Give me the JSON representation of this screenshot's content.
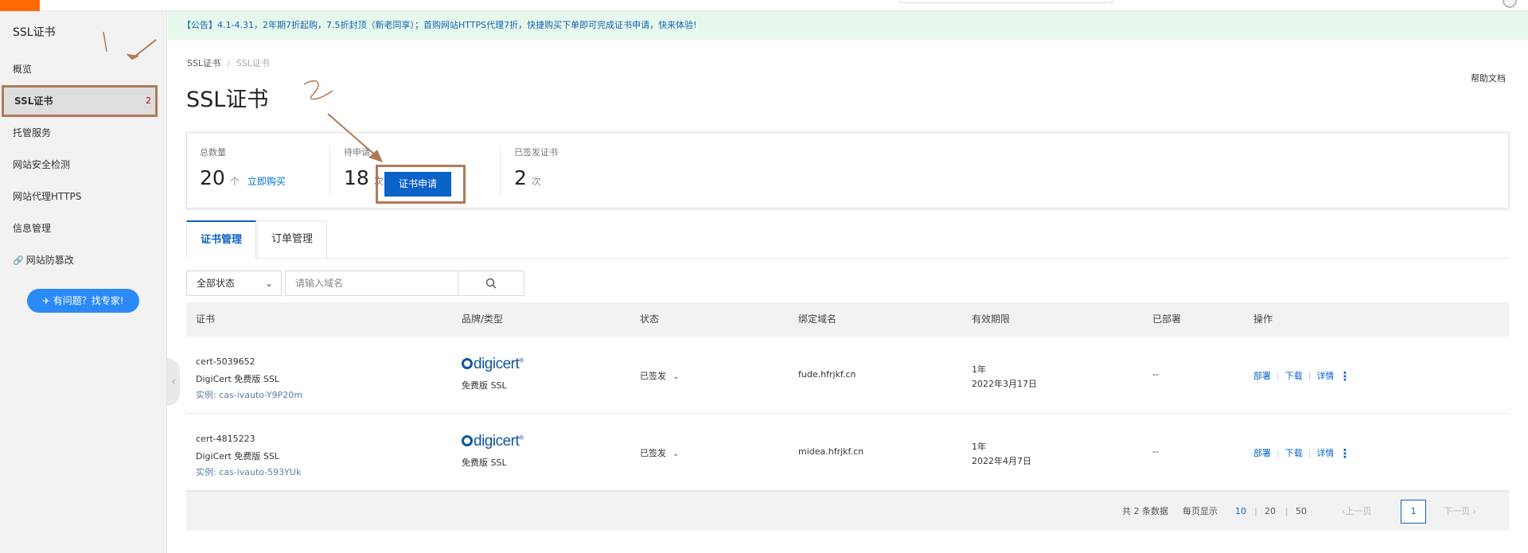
{
  "notice": "【公告】4.1-4.31，2年期7折起购，7.5折封顶（新老同享）；首购网站HTTPS代理7折，快捷购买下单即可完成证书申请，快来体验!",
  "sidebar": {
    "title": "SSL证书",
    "items": [
      {
        "label": "概览"
      },
      {
        "label": "SSL证书",
        "badge": "2"
      },
      {
        "label": "托管服务"
      },
      {
        "label": "网站安全检测"
      },
      {
        "label": "网站代理HTTPS"
      },
      {
        "label": "信息管理"
      },
      {
        "label": "网站防篡改",
        "icon": "link-icon"
      }
    ],
    "help_button": "有问题？找专家!"
  },
  "breadcrumb": {
    "root": "SSL证书",
    "current": "SSL证书"
  },
  "page_title": "SSL证书",
  "help_doc": "帮助文档",
  "stats": {
    "total": {
      "label": "总数量",
      "value": "20",
      "unit": "个",
      "link": "立即购买"
    },
    "pending": {
      "label": "待申请",
      "value": "18",
      "unit": "次",
      "button": "证书申请"
    },
    "issued": {
      "label": "已签发证书",
      "value": "2",
      "unit": "次"
    }
  },
  "tabs": [
    {
      "label": "证书管理",
      "active": true
    },
    {
      "label": "订单管理",
      "active": false
    }
  ],
  "filter": {
    "status_selected": "全部状态",
    "search_placeholder": "请输入域名"
  },
  "table": {
    "columns": [
      "证书",
      "品牌/类型",
      "状态",
      "绑定域名",
      "有效期限",
      "已部署",
      "操作"
    ],
    "rows": [
      {
        "cert_id": "cert-5039652",
        "cert_name": "DigiCert 免费版 SSL",
        "instance": "实例: cas-ivauto-Y9P20m",
        "brand_logo": "digicert",
        "brand_type": "免费版 SSL",
        "status": "已签发",
        "domain": "fude.hfrjkf.cn",
        "validity_period": "1年",
        "validity_date": "2022年3月17日",
        "deployed": "--",
        "actions": [
          "部署",
          "下载",
          "详情"
        ]
      },
      {
        "cert_id": "cert-4815223",
        "cert_name": "DigiCert 免费版 SSL",
        "instance": "实例: cas-ivauto-593YUk",
        "brand_logo": "digicert",
        "brand_type": "免费版 SSL",
        "status": "已签发",
        "domain": "midea.hfrjkf.cn",
        "validity_period": "1年",
        "validity_date": "2022年4月7日",
        "deployed": "--",
        "actions": [
          "部署",
          "下载",
          "详情"
        ]
      }
    ]
  },
  "pagination": {
    "total_text": "共 2 条数据",
    "per_page_label": "每页显示",
    "sizes": [
      "10",
      "20",
      "50"
    ],
    "active_size": "10",
    "prev": "上一页",
    "page": "1",
    "next": "下一页"
  },
  "colors": {
    "accent": "#0b62c7",
    "annotation": "#b07a55",
    "notice_bg": "#e6f7ec"
  }
}
